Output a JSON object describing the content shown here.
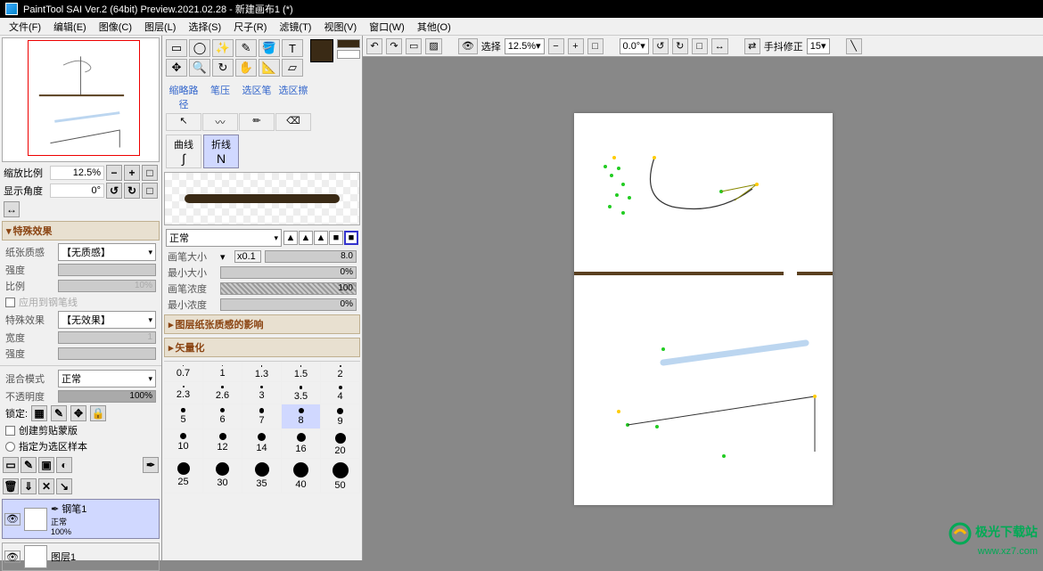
{
  "title": "PaintTool SAI Ver.2 (64bit) Preview.2021.02.28 - 新建画布1 (*)",
  "menu": [
    "文件(F)",
    "编辑(E)",
    "图像(C)",
    "图层(L)",
    "选择(S)",
    "尺子(R)",
    "滤镜(T)",
    "视图(V)",
    "窗口(W)",
    "其他(O)"
  ],
  "navigator": {
    "zoom_label": "缩放比例",
    "zoom_value": "12.5%",
    "angle_label": "显示角度",
    "angle_value": "0°"
  },
  "fx": {
    "header": "特殊效果",
    "paper_label": "纸张质感",
    "paper_value": "【无质感】",
    "strength_label": "强度",
    "ratio_label": "比例",
    "ratio_value": "10%",
    "apply_pen_label": "应用到钢笔线",
    "effect_label": "特殊效果",
    "effect_value": "【无效果】",
    "width_label": "宽度",
    "width_value": "1",
    "strength2_label": "强度"
  },
  "blend": {
    "mode_label": "混合模式",
    "mode_value": "正常",
    "opacity_label": "不透明度",
    "opacity_value": "100%",
    "lock_label": "锁定:",
    "clip_label": "创建剪贴蒙版",
    "select_sample_label": "指定为选区样本"
  },
  "layers": [
    {
      "name": "钢笔1",
      "mode": "正常",
      "opacity": "100%",
      "selected": true
    },
    {
      "name": "图层1",
      "selected": false
    }
  ],
  "tools": {
    "row2_headers": [
      "缩略路径",
      "笔压",
      "选区笔",
      "选区擦"
    ],
    "curve_label": "曲线",
    "polyline_label": "折线"
  },
  "brush": {
    "mode_value": "正常",
    "size_label": "画笔大小",
    "size_mult": "x0.1",
    "size_value": "8.0",
    "min_size_label": "最小大小",
    "min_size_value": "0%",
    "density_label": "画笔浓度",
    "density_value": "100",
    "min_density_label": "最小浓度",
    "min_density_value": "0%",
    "section_paper": "图层纸张质感的影响",
    "section_vector": "矢量化",
    "sizes": [
      {
        "v": "0.7"
      },
      {
        "v": "1"
      },
      {
        "v": "1.3"
      },
      {
        "v": "1.5"
      },
      {
        "v": "2"
      },
      {
        "v": "2.3"
      },
      {
        "v": "2.6"
      },
      {
        "v": "3"
      },
      {
        "v": "3.5"
      },
      {
        "v": "4"
      },
      {
        "v": "5"
      },
      {
        "v": "6"
      },
      {
        "v": "7"
      },
      {
        "v": "8",
        "sel": true
      },
      {
        "v": "9"
      },
      {
        "v": "10"
      },
      {
        "v": "12"
      },
      {
        "v": "14"
      },
      {
        "v": "16"
      },
      {
        "v": "20"
      },
      {
        "v": "25"
      },
      {
        "v": "30"
      },
      {
        "v": "35"
      },
      {
        "v": "40"
      },
      {
        "v": "50"
      }
    ]
  },
  "toolbar": {
    "select_label": "选择",
    "zoom": "12.5%",
    "angle": "0.0°",
    "stabilizer_label": "手抖修正",
    "stabilizer_value": "15"
  },
  "watermark": {
    "line1": "极光下载站",
    "line2": "www.xz7.com"
  }
}
